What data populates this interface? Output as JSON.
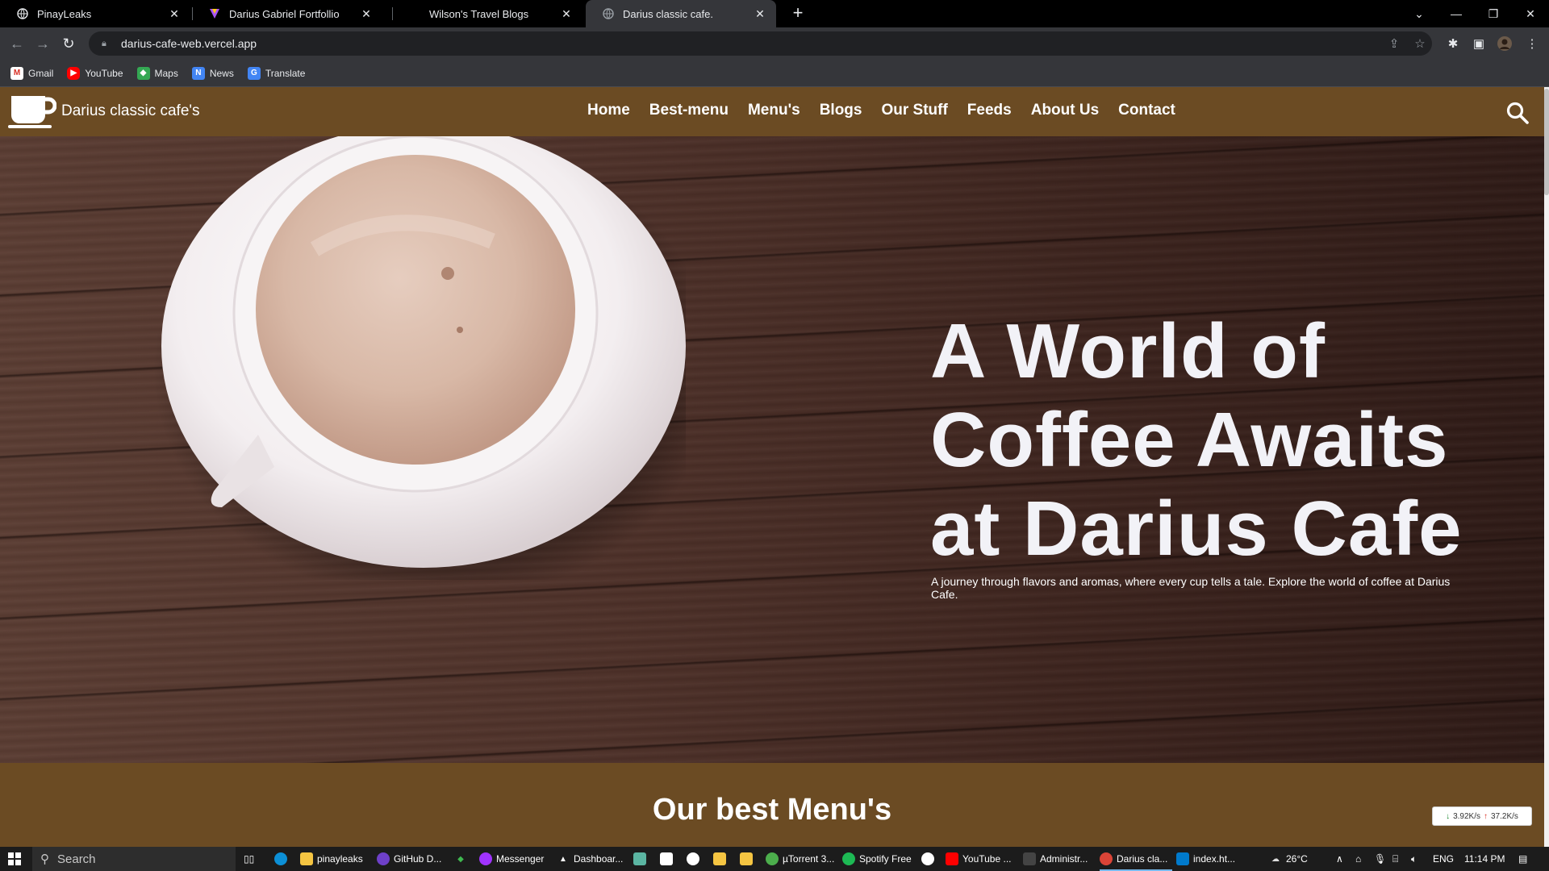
{
  "browser": {
    "tabs": [
      {
        "title": "PinayLeaks",
        "active": false
      },
      {
        "title": "Darius Gabriel Fortfollio",
        "active": false
      },
      {
        "title": "Wilson's Travel Blogs",
        "active": false
      },
      {
        "title": "Darius classic cafe.",
        "active": true
      }
    ],
    "url": "darius-cafe-web.vercel.app",
    "bookmarks": [
      {
        "label": "Gmail",
        "icon": "gmail-icon"
      },
      {
        "label": "YouTube",
        "icon": "youtube-icon"
      },
      {
        "label": "Maps",
        "icon": "maps-icon"
      },
      {
        "label": "News",
        "icon": "news-icon"
      },
      {
        "label": "Translate",
        "icon": "translate-icon"
      }
    ]
  },
  "site": {
    "brand": "Darius classic cafe's",
    "nav": [
      "Home",
      "Best-menu",
      "Menu's",
      "Blogs",
      "Our Stuff",
      "Feeds",
      "About Us",
      "Contact"
    ],
    "hero_title_lines": [
      "A World of",
      "Coffee Awaits",
      "at Darius Cafe"
    ],
    "hero_subtitle": "A journey through flavors and aromas, where every cup tells a tale. Explore the world of coffee at Darius Cafe.",
    "section_title": "Our best Menu's",
    "colors": {
      "nav_bg": "#6b4b23",
      "hero_text": "#f2f2f7"
    }
  },
  "netspeed": {
    "down": "3.92K/s",
    "up": "37.2K/s"
  },
  "taskbar": {
    "search_placeholder": "Search",
    "items": [
      "pinayleaks",
      "GitHub D...",
      "Messenger",
      "Dashboar...",
      "µTorrent 3...",
      "Spotify Free",
      "YouTube ...",
      "Administr...",
      "Darius cla...",
      "index.ht..."
    ],
    "weather": "26°C",
    "language": "ENG",
    "time": "11:14 PM"
  }
}
